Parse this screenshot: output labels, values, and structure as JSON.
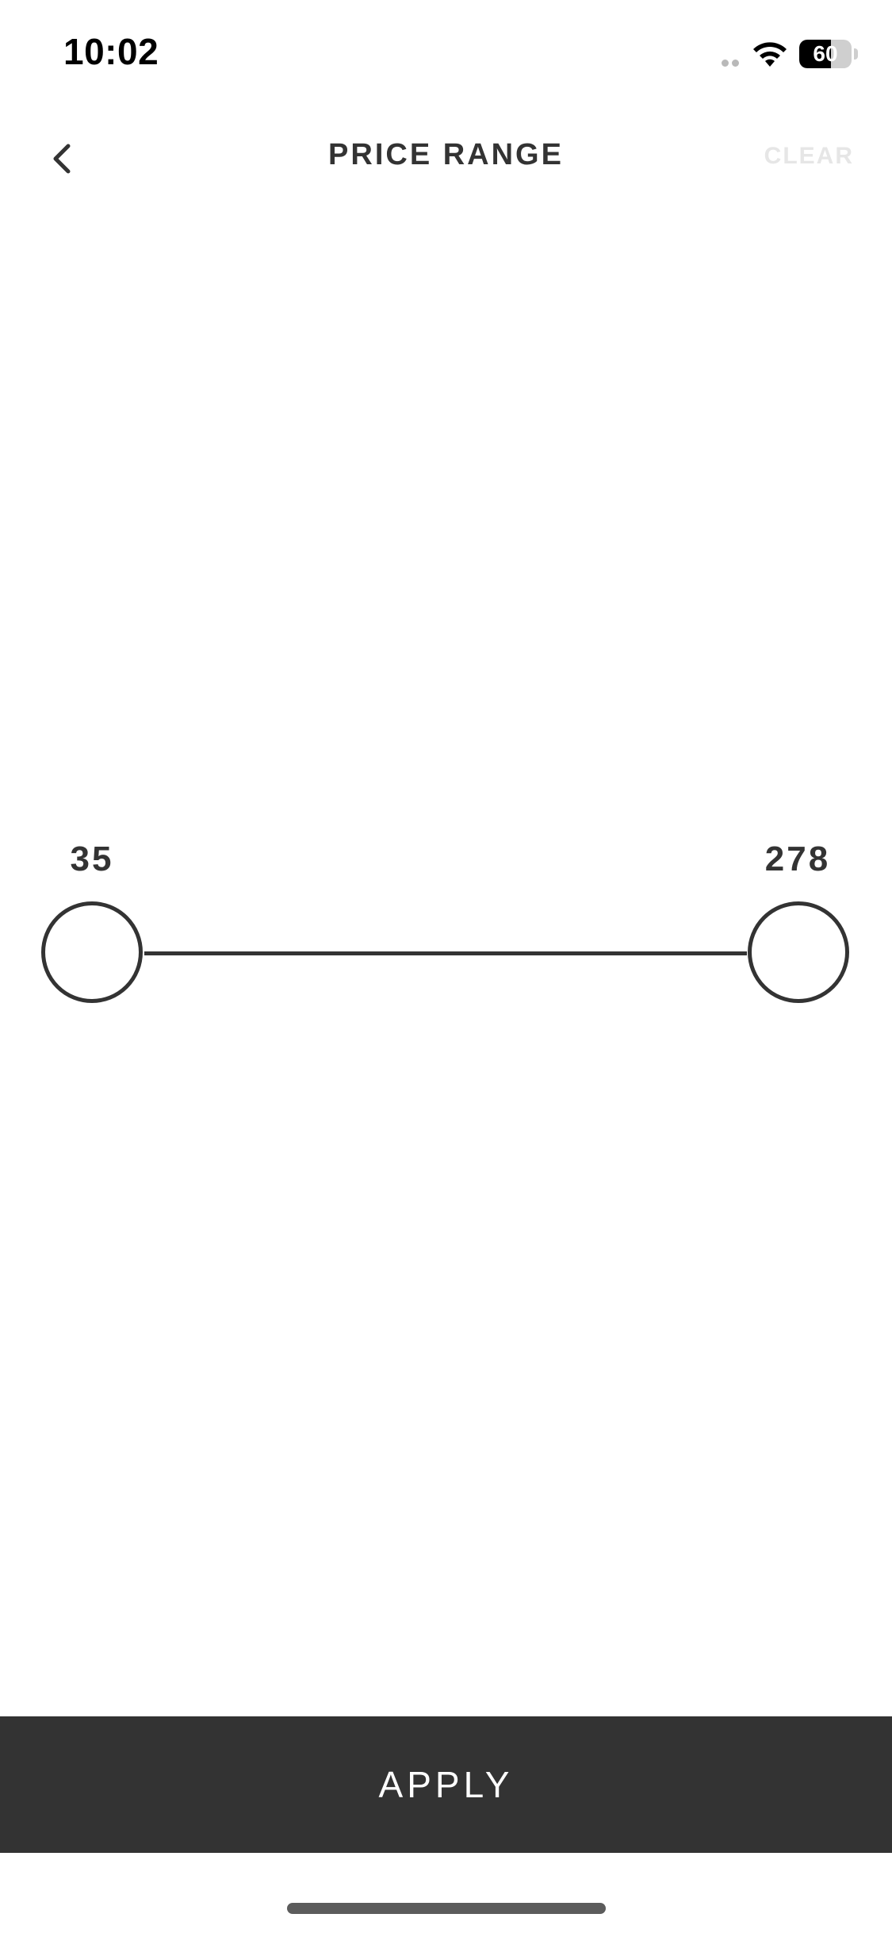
{
  "status_bar": {
    "time": "10:02",
    "battery_level": "60",
    "battery_fraction": 0.6,
    "icons": [
      "cellular-signal-icon",
      "wifi-icon",
      "battery-icon"
    ]
  },
  "header": {
    "back_icon": "chevron-left-icon",
    "title": "PRICE RANGE",
    "clear_label": "CLEAR"
  },
  "range_slider": {
    "min_label": "35",
    "max_label": "278"
  },
  "footer": {
    "apply_label": "APPLY"
  },
  "colors": {
    "primary": "#333333",
    "background": "#ffffff",
    "disabled_text": "#e6e6e6"
  }
}
